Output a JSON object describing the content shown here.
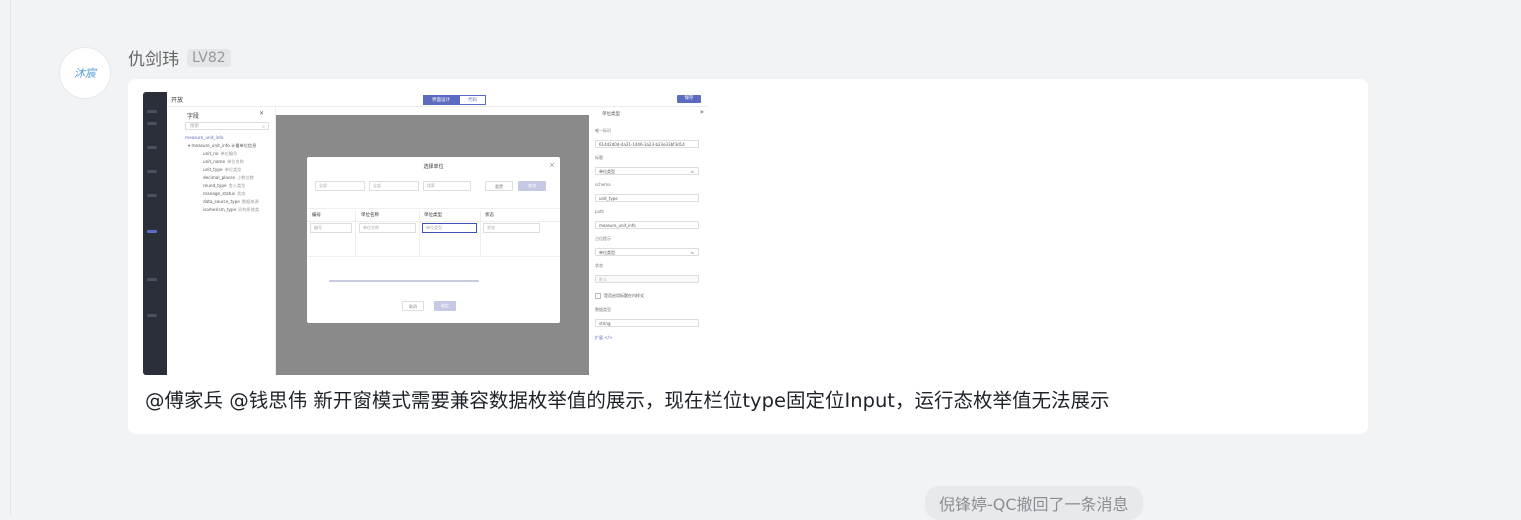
{
  "sender": {
    "avatar_text": "沐宸",
    "name": "仇剑玮",
    "level": "LV82"
  },
  "message": {
    "text": "@傅家兵 @钱思伟 新开窗模式需要兼容数据枚举值的展示，现在栏位type固定位Input，运行态枚举值无法展示"
  },
  "screenshot": {
    "app_title": "开放",
    "tabs": [
      "界面设计",
      "代码"
    ],
    "save_label": "保存",
    "close_icon": "×",
    "field_panel": {
      "title": "字段",
      "search_placeholder": "搜索",
      "root": "measure_unit_info",
      "group": "measure_unit_info 计量单位信息",
      "fields": [
        {
          "name": "unit_no",
          "desc": "单位编号"
        },
        {
          "name": "unit_name",
          "desc": "单位名称"
        },
        {
          "name": "unit_type",
          "desc": "单位类型"
        },
        {
          "name": "decimal_places",
          "desc": "小数位数"
        },
        {
          "name": "round_type",
          "desc": "舍入类型"
        },
        {
          "name": "manage_status",
          "desc": "状态"
        },
        {
          "name": "data_source_type",
          "desc": "数据来源"
        },
        {
          "name": "isomerism_type",
          "desc": "异构系统类"
        }
      ]
    },
    "dialog": {
      "title": "选择单位",
      "filters": [
        "全部",
        "全部",
        "搜索"
      ],
      "query_label": "查询",
      "reset_label": "重置",
      "headers": [
        "编号",
        "单位名称",
        "单位类型",
        "状态"
      ],
      "cells": [
        "编号",
        "单位名称",
        "单位类型",
        "状态"
      ],
      "cancel_label": "取消",
      "confirm_label": "确定"
    },
    "props": {
      "header": "单位类型",
      "expand_icon": "»",
      "id_label": "唯一标识",
      "id_value": "614d2d0d-4a31-1446-3a23-b23e33bf3d14",
      "title_label": "标题",
      "title_value": "单位类型",
      "schema_label": "schema",
      "schema_value": "unit_type",
      "path_label": "path",
      "path_value": "measure_unit_info",
      "placeholder_label": "占位提示",
      "placeholder_value": "单位类型",
      "status_label": "状态",
      "status_value": "默认",
      "checkbox_label": "是否启用标题在内样式",
      "datatype_label": "数据类型",
      "datatype_value": "string",
      "extend_label": "扩展 </>"
    }
  },
  "system_notice": "倪锋婷-QC撤回了一条消息"
}
